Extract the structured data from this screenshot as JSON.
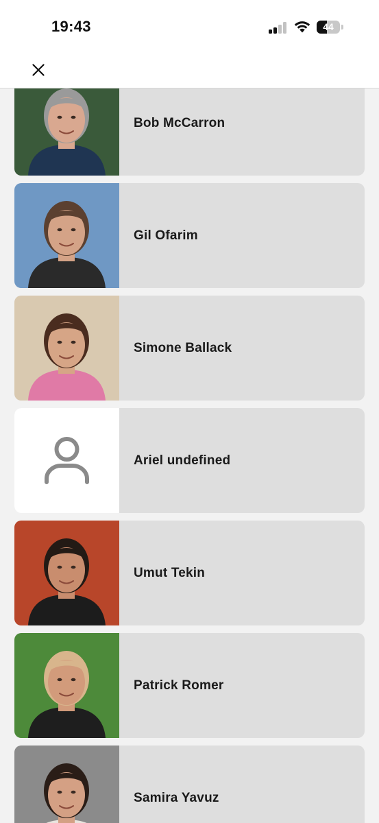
{
  "status_bar": {
    "time": "19:43",
    "battery_level": "44",
    "battery_percent": 44,
    "icons": [
      "cellular-signal-icon",
      "wifi-icon",
      "battery-icon"
    ]
  },
  "header": {
    "close_icon": "close-icon"
  },
  "people": [
    {
      "name": "Bob McCarron",
      "photo": "portrait",
      "bg": "#3a5a3a",
      "hair": "#9a9a9a",
      "skin": "#d9a890",
      "shirt": "#1f3552"
    },
    {
      "name": "Gil Ofarim",
      "photo": "portrait",
      "bg": "#6f98c4",
      "hair": "#5b4030",
      "skin": "#d4a387",
      "shirt": "#2a2a2a"
    },
    {
      "name": "Simone Ballack",
      "photo": "portrait",
      "bg": "#d9c9b0",
      "hair": "#4a2c1f",
      "skin": "#d6a586",
      "shirt": "#e07aa6"
    },
    {
      "name": "Ariel undefined",
      "photo": "placeholder",
      "bg": "#ffffff"
    },
    {
      "name": "Umut Tekin",
      "photo": "portrait",
      "bg": "#b8462a",
      "hair": "#231a15",
      "skin": "#c98d6e",
      "shirt": "#1c1c1c"
    },
    {
      "name": "Patrick Romer",
      "photo": "portrait",
      "bg": "#4d8a3a",
      "hair": "#d8b58c",
      "skin": "#d29b7b",
      "shirt": "#1e1e1e"
    },
    {
      "name": "Samira Yavuz",
      "photo": "portrait",
      "bg": "#8b8b8b",
      "hair": "#2a1d17",
      "skin": "#d4a084",
      "shirt": "#e9e4de"
    }
  ],
  "colors": {
    "card_background": "#dedede",
    "page_background": "#f2f2f2",
    "placeholder_icon": "#8a8a8a"
  }
}
